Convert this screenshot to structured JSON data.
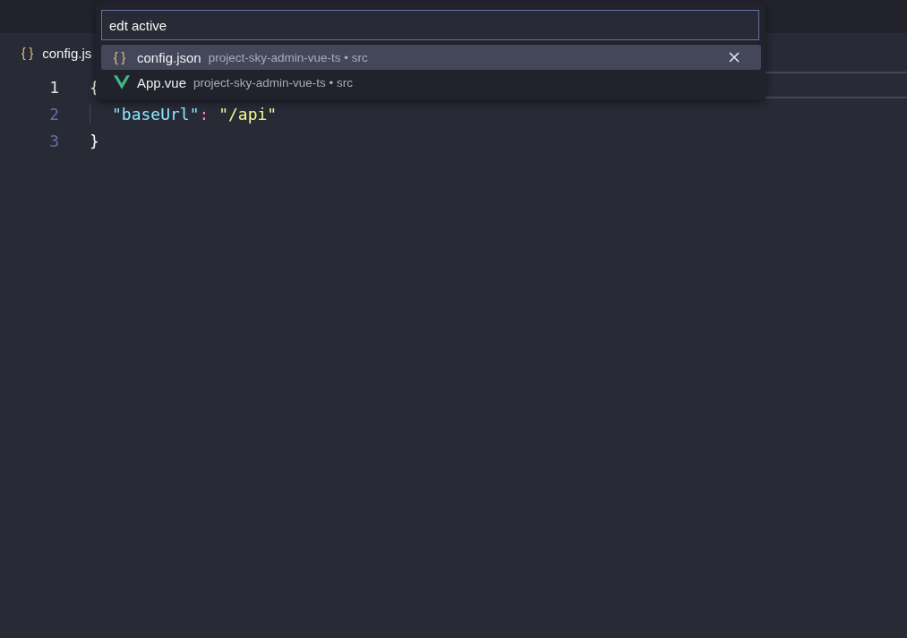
{
  "tab": {
    "icon": "{ }",
    "label": "config.js"
  },
  "editor": {
    "lines": [
      {
        "number": "1",
        "active": true,
        "indented": false,
        "tokens": [
          {
            "kind": "brace",
            "text": "{"
          }
        ]
      },
      {
        "number": "2",
        "active": false,
        "indented": true,
        "tokens": [
          {
            "kind": "key",
            "text": "\"baseUrl\""
          },
          {
            "kind": "punct",
            "text": ":"
          },
          {
            "kind": "string",
            "text": "\"/api\""
          }
        ]
      },
      {
        "number": "3",
        "active": false,
        "indented": false,
        "tokens": [
          {
            "kind": "brace",
            "text": "}"
          }
        ]
      }
    ]
  },
  "quick_open": {
    "value": "edt active",
    "results": [
      {
        "kind": "json",
        "icon": "{ }",
        "name": "config.json",
        "description": "project-sky-admin-vue-ts • src",
        "selected": true
      },
      {
        "kind": "vue",
        "name": "App.vue",
        "description": "project-sky-admin-vue-ts • src",
        "selected": false
      }
    ]
  }
}
